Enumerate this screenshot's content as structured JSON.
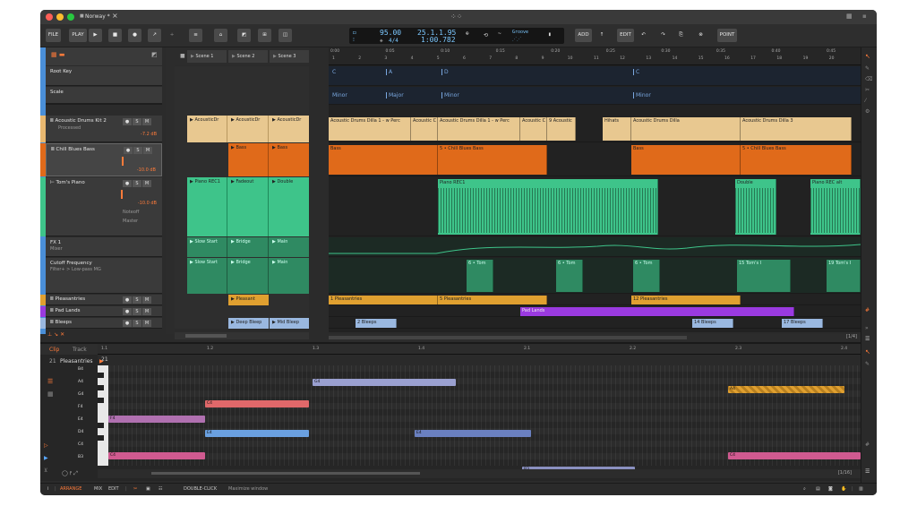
{
  "window": {
    "title": "Norway *"
  },
  "toolbar": {
    "file": "FILE",
    "play": "PLAY",
    "add": "ADD",
    "edit": "EDIT",
    "point": "POINT",
    "tempo": "95.00",
    "time_sig": "4/4",
    "position": "25.1.1.95",
    "time": "1:00.782",
    "groove": "Groove"
  },
  "scenes": [
    "Scene 1",
    "Scene 2",
    "Scene 3"
  ],
  "ruler": {
    "bars": [
      "1",
      "2",
      "3",
      "4",
      "5",
      "6",
      "7",
      "8",
      "9",
      "10",
      "11",
      "12",
      "13",
      "14",
      "15",
      "16",
      "17",
      "18",
      "19",
      "20"
    ],
    "times": [
      "0:00",
      "0:05",
      "0:10",
      "0:15",
      "0:20",
      "0:25",
      "0:30",
      "0:35",
      "0:40",
      "0:45"
    ]
  },
  "tracks": [
    {
      "name": "Root Key",
      "sub": "",
      "color": "#4a8fd8",
      "vol": ""
    },
    {
      "name": "Scale",
      "sub": "",
      "color": "#4a8fd8",
      "vol": ""
    },
    {
      "name": "Acoustic Drums Kit 2",
      "sub": "Processed",
      "color": "#e8b870",
      "vol": "-7.2 dB"
    },
    {
      "name": "Chill Blues Bass",
      "sub": "",
      "color": "#e06a1a",
      "vol": "-10.0 dB"
    },
    {
      "name": "Tom's Piano",
      "sub": "",
      "color": "#3ec48a",
      "vol": "-10.0 dB"
    },
    {
      "name": "FX 1",
      "sub": "Mixer",
      "color": "#3ec48a",
      "vol": ""
    },
    {
      "name": "Cutoff Frequency",
      "sub": "Filter+ > Low-pass MG",
      "color": "#3ec48a",
      "vol": ""
    },
    {
      "name": "Pleasantries",
      "sub": "",
      "color": "#e0a030",
      "vol": ""
    },
    {
      "name": "Pad Lands",
      "sub": "",
      "color": "#9a3ae0",
      "vol": ""
    },
    {
      "name": "Bleeps",
      "sub": "",
      "color": "#9ab8e0",
      "vol": ""
    }
  ],
  "piano_sub": {
    "noteoff": "Noteoff",
    "master": "Master"
  },
  "launcher": {
    "drums": [
      "AcousticDr",
      "AcousticDr",
      "AcousticDr"
    ],
    "bass": [
      "",
      "Bass",
      "Bass"
    ],
    "piano": [
      "Piano REC1",
      "Fadeout",
      "Double"
    ],
    "fx": [
      "Slow Start",
      "Bridge",
      "Main"
    ],
    "cutoff": [
      "Slow Start",
      "Bridge",
      "Main"
    ],
    "pleasant": [
      "",
      "Pleasant",
      ""
    ],
    "bleeps": [
      "",
      "Deep Bleep",
      "Mid Bleep"
    ]
  },
  "arrangement": {
    "root_key": [
      "C",
      "A",
      "D",
      "C"
    ],
    "scale": [
      "Minor",
      "Major",
      "Minor",
      "Minor"
    ],
    "drums": [
      "Acoustic Drums Dilla 1 - w Perc",
      "Acoustic C",
      "Acoustic Drums Dilla 1 - w Perc",
      "Acoustic C",
      "9 Acoustic",
      "Hihats",
      "Acoustic Drums Dilla",
      "Acoustic Drums Dilla 3"
    ],
    "bass": [
      "Bass",
      "5 • Chill Blues Bass",
      "Bass",
      "5 • Chill Blues Bass"
    ],
    "piano": [
      "Piano REC1",
      "Double",
      "Piano REC alt"
    ],
    "fx_labels": [
      "6 • Tom",
      "6 • Tom",
      "6 • Tom",
      "15 Tom's I",
      "19 Tom's I"
    ],
    "pleasant": [
      "1 Pleasantries",
      "5 Pleasantries",
      "12 Pleasantries"
    ],
    "pad": [
      "Pad Lands"
    ],
    "bleeps": [
      "2 Bleeps",
      "14 Bleeps",
      "17 Bleeps"
    ]
  },
  "editor": {
    "tabs": [
      "Clip",
      "Track"
    ],
    "clip_name": "Pleasantries",
    "clip_num": "21",
    "bars": [
      "1.1",
      "1.2",
      "1.3",
      "1.4",
      "2.1",
      "2.2",
      "2.3",
      "2.4"
    ],
    "keys": [
      "B4",
      "A4",
      "G4",
      "F4",
      "E4",
      "D4",
      "C4",
      "B3"
    ],
    "note_labels": [
      "G4",
      "C4",
      "F4",
      "E4",
      "C4",
      "A4",
      "C4",
      "B3",
      "E4"
    ],
    "page": "[1/16]"
  },
  "arr_page": "[1/4]",
  "status": {
    "arrange": "ARRANGE",
    "mix": "MIX",
    "edit": "EDIT",
    "hint_key": "DOUBLE-CLICK",
    "hint": "Maximize window"
  }
}
